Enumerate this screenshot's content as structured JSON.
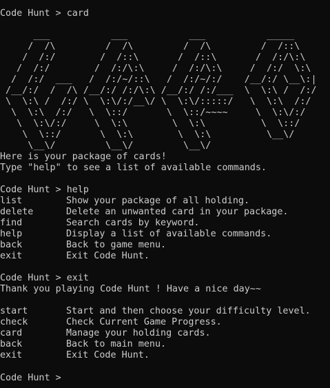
{
  "terminal": {
    "line_prompt_1": "Code Hunt > card",
    "ascii_art": [
      "      ___           ___           ___           _____",
      "     /  /\\         /  /\\         /  /\\         /  /::\\",
      "    /  /:/        /  /::\\       /  /::\\       /  /:/\\:\\",
      "   /  /:/        /  /:/\\:\\     /  /:/\\:\\     /  /:/  \\:\\",
      "  /  /:/  ___   /  /:/~/::\\   /  /:/~/:/    /__/:/ \\__\\:|",
      " /__/:/  /  /\\ /__/:/ /:/\\:\\ /__/:/ /:/___  \\  \\:\\ /  /:/",
      " \\  \\:\\ /  /:/ \\  \\:\\/:/__\\/ \\  \\:\\/:::::/   \\  \\:\\  /:/",
      "  \\  \\:\\  /:/   \\  \\::/       \\  \\::/~~~~     \\  \\:\\/:/",
      "   \\  \\:\\/:/     \\  \\:\\        \\  \\:\\          \\  \\::/",
      "    \\  \\::/       \\  \\:\\        \\  \\:\\          \\__\\/",
      "     \\__\\/         \\__\\/         \\__\\/"
    ],
    "welcome_1": "Here is your package of cards!",
    "welcome_2": "Type \"help\" to see a list of available commands.",
    "line_prompt_2": "Code Hunt > help",
    "help_commands": [
      {
        "cmd": "list",
        "desc": "Show your package of all holding."
      },
      {
        "cmd": "delete",
        "desc": "Delete an unwanted card in your package."
      },
      {
        "cmd": "find",
        "desc": "Search cards by keyword."
      },
      {
        "cmd": "help",
        "desc": "Display a list of available commands."
      },
      {
        "cmd": "back",
        "desc": "Back to game menu."
      },
      {
        "cmd": "exit",
        "desc": "Exit Code Hunt."
      }
    ],
    "line_prompt_3": "Code Hunt > exit",
    "goodbye": "Thank you playing Code Hunt ! Have a nice day~~",
    "main_commands": [
      {
        "cmd": "start",
        "desc": "Start and then choose your difficulty level."
      },
      {
        "cmd": "check",
        "desc": "Check Current Game Progress."
      },
      {
        "cmd": "card",
        "desc": "Manage your holding cards."
      },
      {
        "cmd": "back",
        "desc": "Back to main menu."
      },
      {
        "cmd": "exit",
        "desc": "Exit Code Hunt."
      }
    ],
    "current_prompt": "Code Hunt > "
  }
}
